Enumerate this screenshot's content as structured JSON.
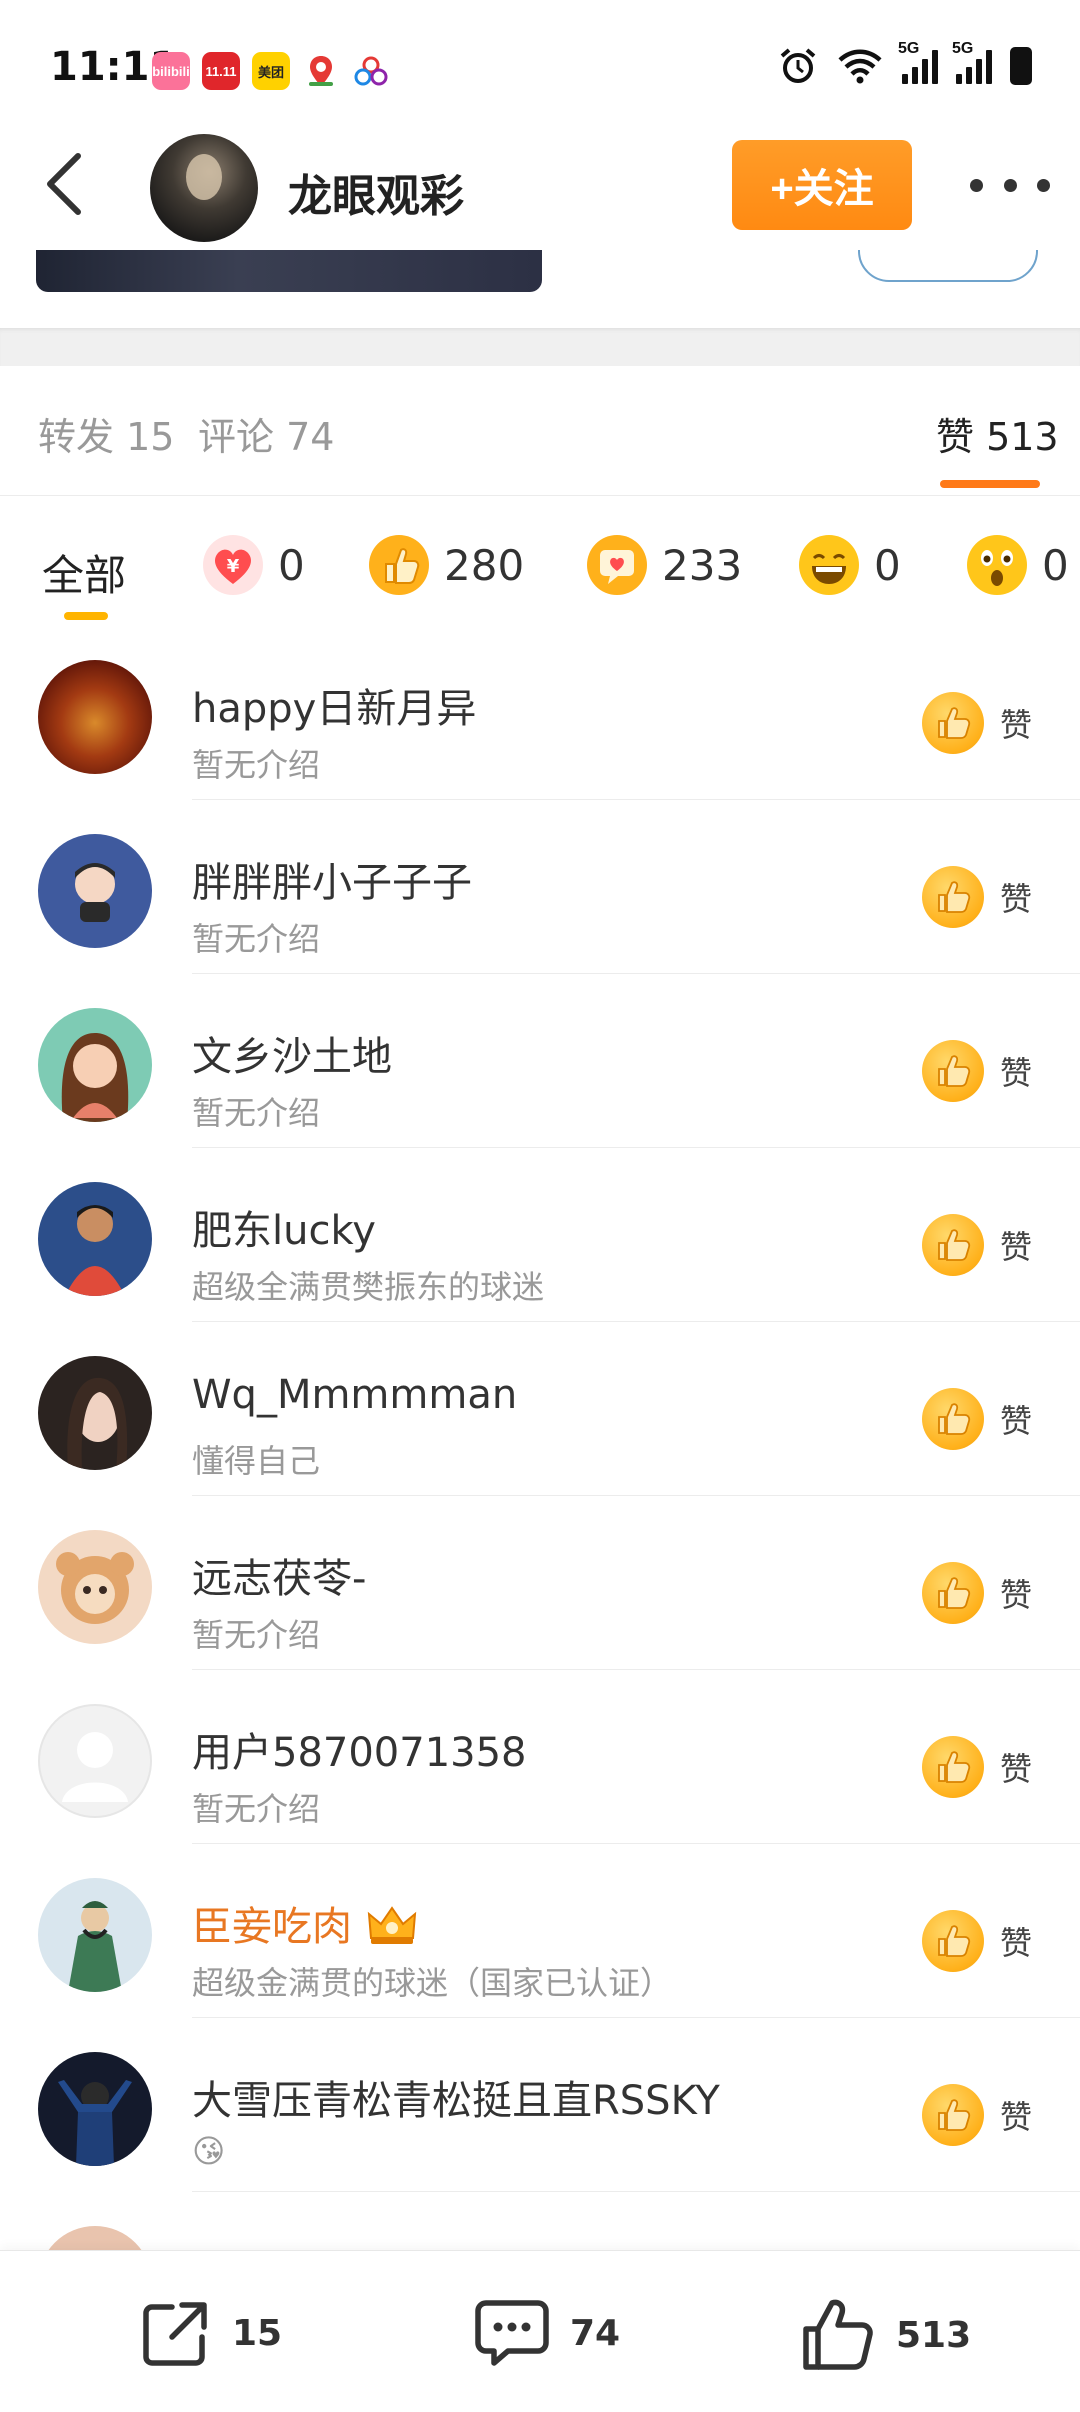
{
  "status_bar": {
    "time": "11:11",
    "apps": [
      {
        "icon": "bilibili-icon",
        "label": "bilibili",
        "color": "#fb7299"
      },
      {
        "icon": "tmall-1111-icon",
        "label": "11.11",
        "color": "#e0262b"
      },
      {
        "icon": "meituan-icon",
        "label": "美团",
        "color": "#ffd100"
      },
      {
        "icon": "map-pin-icon",
        "label": "",
        "color": "#ffffff"
      },
      {
        "icon": "cloud-app-icon",
        "label": "",
        "color": "#ffffff"
      }
    ],
    "network": "5G"
  },
  "header": {
    "account_name": "龙眼观彩",
    "follow_label": "+关注"
  },
  "tabs": [
    {
      "label": "转发 15"
    },
    {
      "label": "评论 74"
    },
    {
      "label": "赞 513",
      "active": true
    }
  ],
  "reaction_filter": {
    "all_label": "全部",
    "items": [
      {
        "icon": "heart-yuan-icon",
        "count": "0",
        "color": "#ff4d4f"
      },
      {
        "icon": "thumbs-up-icon",
        "count": "280",
        "color": "#ffb11b"
      },
      {
        "icon": "heart-message-icon",
        "count": "233",
        "color": "#ffb11b"
      },
      {
        "icon": "laughing-face-icon",
        "count": "0",
        "color": "#ffc61a"
      },
      {
        "icon": "surprised-face-icon",
        "count": "0",
        "color": "#ffc61a"
      }
    ]
  },
  "like_label": "赞",
  "users": [
    {
      "name": "happy日新月异",
      "bio": "暂无介绍"
    },
    {
      "name": "胖胖胖小子子子",
      "bio": "暂无介绍"
    },
    {
      "name": "文乡沙土地",
      "bio": "暂无介绍"
    },
    {
      "name": "肥东lucky",
      "bio": "超级全满贯樊振东的球迷"
    },
    {
      "name": "Wq_Mmmmman",
      "bio": "懂得自己"
    },
    {
      "name": "远志茯苓-",
      "bio": "暂无介绍"
    },
    {
      "name": "用户5870071358",
      "bio": "暂无介绍"
    },
    {
      "name": "臣妾吃肉",
      "bio": "超级金满贯的球迷（国家已认证）",
      "vip": true
    },
    {
      "name": "大雪压青松青松挺且直RSSKY",
      "bio": "😘"
    }
  ],
  "bottom_bar": {
    "repost_count": "15",
    "comment_count": "74",
    "like_count": "513"
  },
  "colors": {
    "accent_orange": "#ff8a12",
    "vip_name": "#e87722",
    "emoji_yellow": "#ffb11b"
  }
}
